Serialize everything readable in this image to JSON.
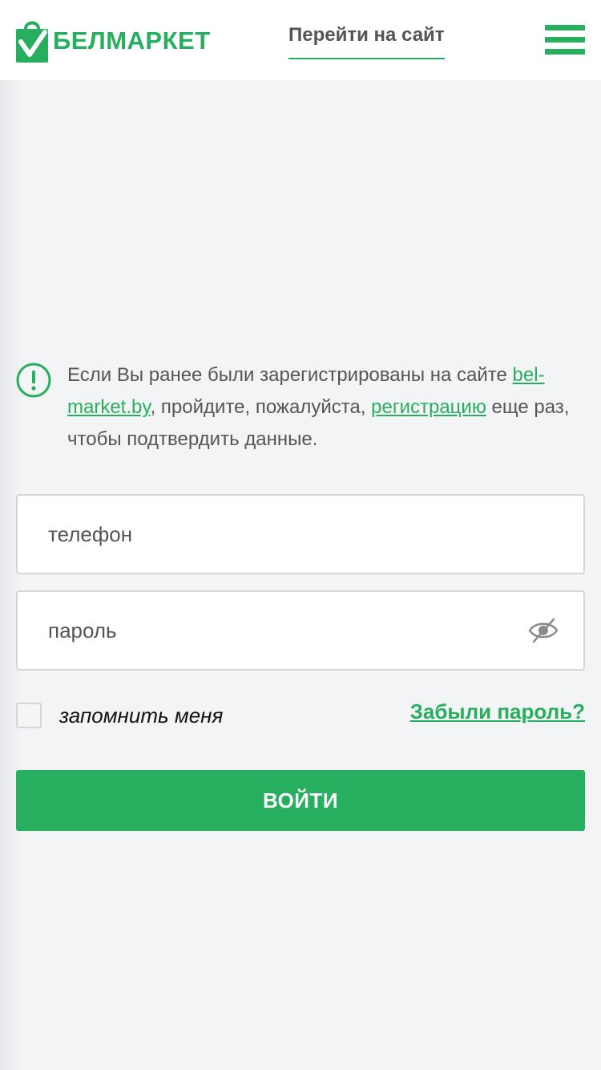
{
  "colors": {
    "brand": "#27ae5f",
    "text": "#555555",
    "background": "#f3f4f6",
    "border": "#d4d5d8"
  },
  "header": {
    "logo_text": "БЕЛМАРКЕТ",
    "logo_icon": "shopping-bag-check-icon",
    "goto_site": "Перейти на сайт",
    "menu_icon": "hamburger-menu-icon"
  },
  "notice": {
    "icon": "exclamation-circle-icon",
    "part1": "Если Вы ранее были зарегистрированы на сайте ",
    "site_link": "bel-market.by",
    "part2": ", пройдите, пожалуйста, ",
    "registration_link": "регистрацию",
    "part3": " еще раз, чтобы подтвердить данные."
  },
  "form": {
    "phone_placeholder": "телефон",
    "password_placeholder": "пароль",
    "eye_icon": "eye-slash-icon",
    "remember_label": "запомнить меня",
    "forgot_link": "Забыли пароль?",
    "submit_label": "ВОЙТИ"
  }
}
